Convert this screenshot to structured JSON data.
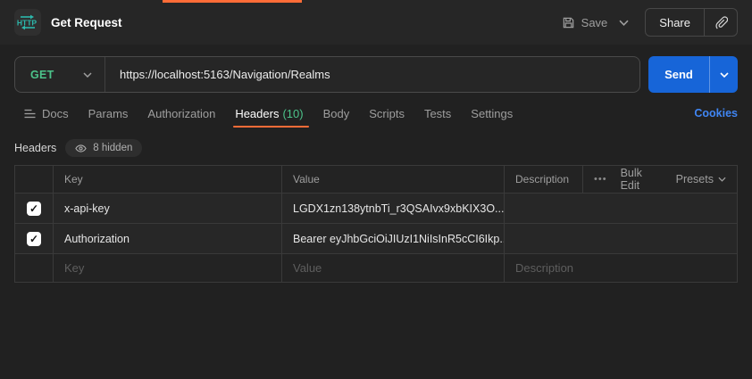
{
  "window": {
    "title": "Get Request"
  },
  "topbar": {
    "save_label": "Save",
    "share_label": "Share"
  },
  "request": {
    "method": "GET",
    "url": "https://localhost:5163/Navigation/Realms",
    "send_label": "Send"
  },
  "tabs": [
    {
      "label": "Docs"
    },
    {
      "label": "Params"
    },
    {
      "label": "Authorization"
    },
    {
      "label": "Headers",
      "count": "(10)",
      "active": true
    },
    {
      "label": "Body"
    },
    {
      "label": "Scripts"
    },
    {
      "label": "Tests"
    },
    {
      "label": "Settings"
    }
  ],
  "cookies_label": "Cookies",
  "headers_section": {
    "title": "Headers",
    "hidden_badge": "8 hidden"
  },
  "table": {
    "columns": {
      "key": "Key",
      "value": "Value",
      "description": "Description"
    },
    "actions": {
      "bulk_edit": "Bulk Edit",
      "presets": "Presets"
    },
    "rows": [
      {
        "checked": true,
        "key": "x-api-key",
        "value": "LGDX1zn138ytnbTi_r3QSAIvx9xbKIX3O...",
        "description": ""
      },
      {
        "checked": true,
        "key": "Authorization",
        "value": "Bearer eyJhbGciOiJIUzI1NiIsInR5cCI6Ikp...",
        "description": ""
      }
    ],
    "placeholder_row": {
      "key": "Key",
      "value": "Value",
      "description": "Description"
    }
  },
  "icons": {
    "http-badge-icon": "HTTP",
    "save-icon": "floppy-disk",
    "chevron-down-icon": "chevron-down",
    "link-icon": "paperclip",
    "docs-icon": "list-lines",
    "eye-icon": "eye",
    "more-options-icon": "ellipsis-dots",
    "check-glyph": "✓"
  },
  "colors": {
    "accent_orange": "#ff6c37",
    "method_green": "#4cc38a",
    "send_blue": "#1765d8",
    "link_blue": "#4086f4"
  }
}
